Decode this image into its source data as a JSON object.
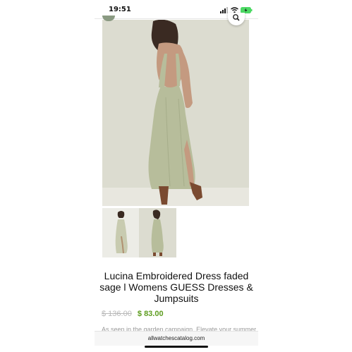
{
  "status_bar": {
    "time": "19:51"
  },
  "product": {
    "title": "Lucina Embroidered Dress faded sage l Womens GUESS Dresses & Jumpsuits",
    "old_price": "$ 136.00",
    "new_price": "$ 83.00",
    "description_snippet": "As seen in the garden campaign. Elevate your summer"
  },
  "browser": {
    "url": "allwatchescatalog.com"
  },
  "colors": {
    "sale_price": "#5d9c1f",
    "dress": "#b7bd9b",
    "background": "#dcdcd0"
  },
  "icons": [
    "signal-icon",
    "wifi-icon",
    "battery-icon",
    "search-icon"
  ]
}
